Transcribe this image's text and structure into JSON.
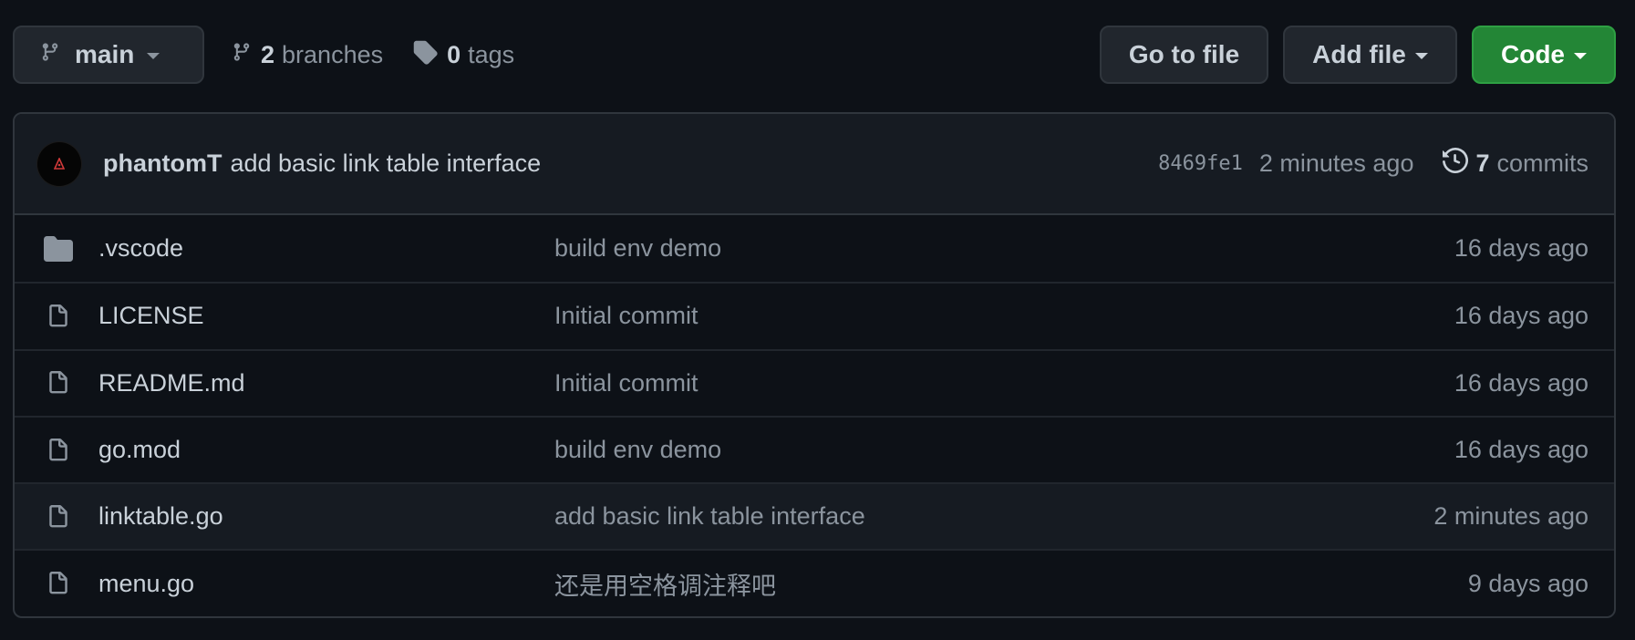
{
  "toolbar": {
    "branch_label": "main",
    "branches_count": "2",
    "branches_label": "branches",
    "tags_count": "0",
    "tags_label": "tags",
    "goto_label": "Go to file",
    "add_label": "Add file",
    "code_label": "Code"
  },
  "commit": {
    "author": "phantomT",
    "message": "add basic link table interface",
    "sha": "8469fe1",
    "time": "2 minutes ago",
    "commits_count": "7",
    "commits_label": "commits"
  },
  "files": [
    {
      "type": "folder",
      "name": ".vscode",
      "message": "build env demo",
      "age": "16 days ago"
    },
    {
      "type": "file",
      "name": "LICENSE",
      "message": "Initial commit",
      "age": "16 days ago"
    },
    {
      "type": "file",
      "name": "README.md",
      "message": "Initial commit",
      "age": "16 days ago"
    },
    {
      "type": "file",
      "name": "go.mod",
      "message": "build env demo",
      "age": "16 days ago"
    },
    {
      "type": "file",
      "name": "linktable.go",
      "message": "add basic link table interface",
      "age": "2 minutes ago"
    },
    {
      "type": "file",
      "name": "menu.go",
      "message": "还是用空格调注释吧",
      "age": "9 days ago"
    }
  ],
  "colors": {
    "background": "#0d1117",
    "border": "#30363d",
    "primary_button": "#238636",
    "muted_text": "#8b949e"
  }
}
